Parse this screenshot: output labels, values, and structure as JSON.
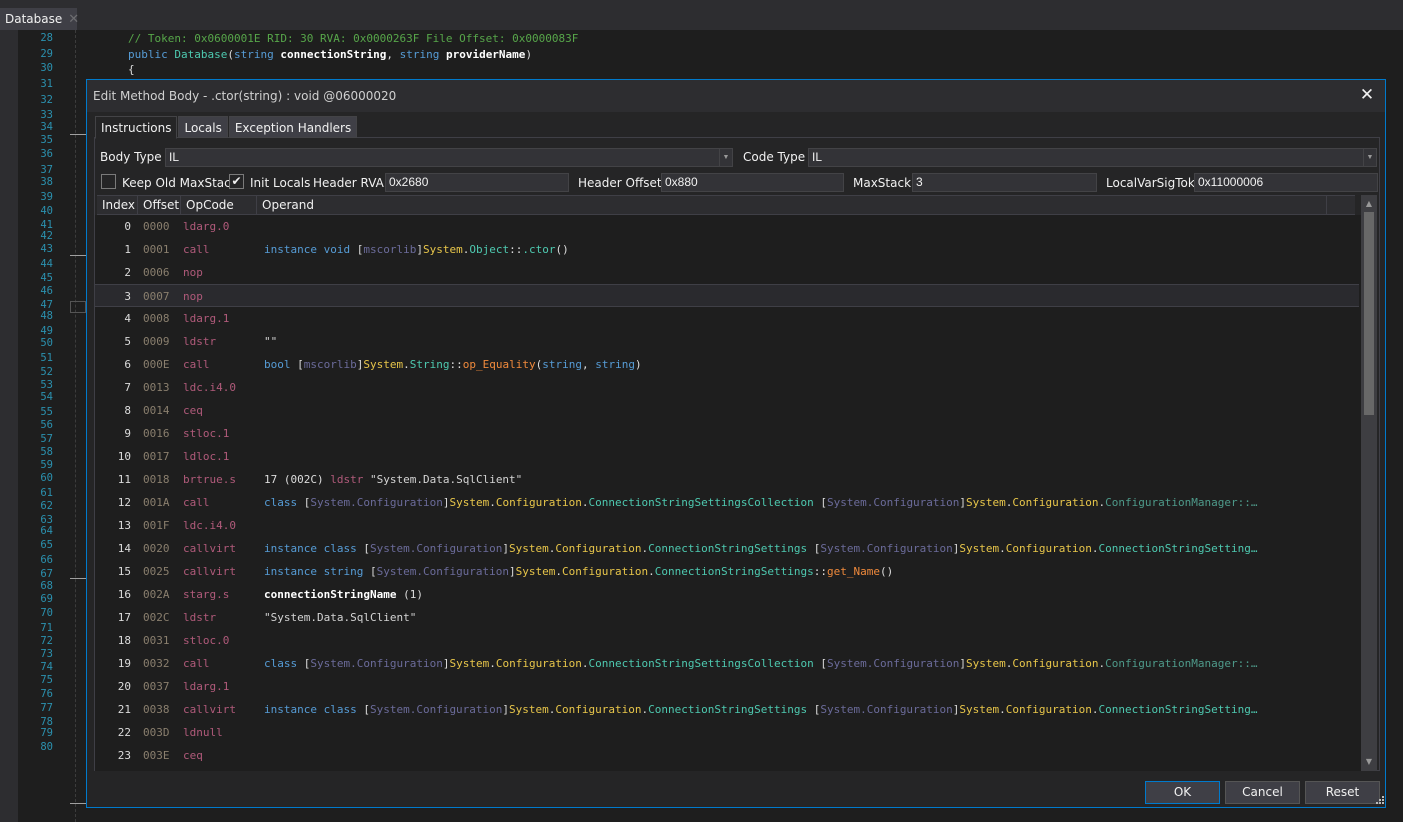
{
  "tab": {
    "label": "Database",
    "close_glyph": "✕"
  },
  "editor": {
    "line_numbers": [
      "28",
      "29",
      "30",
      "31",
      "32",
      "33",
      "34",
      "35",
      "36",
      "37",
      "38",
      "39",
      "40",
      "41",
      "42",
      "43",
      "44",
      "45",
      "46",
      "47",
      "48",
      "49",
      "50",
      "51",
      "52",
      "53",
      "54",
      "55",
      "56",
      "57",
      "58",
      "59",
      "60",
      "61",
      "62",
      "63",
      "64",
      "65",
      "66",
      "67",
      "68",
      "69",
      "70",
      "71",
      "72",
      "73",
      "74",
      "75",
      "76",
      "77",
      "78",
      "79",
      "80"
    ],
    "comment_line": "// Token: 0x0600001E RID: 30 RVA: 0x0000263F File Offset: 0x0000083F",
    "signature": {
      "kw_public": "public",
      "type_name": "Database",
      "open": "(",
      "kw_string1": "string",
      "param1": "connectionString",
      "comma": ", ",
      "kw_string2": "string",
      "param2": "providerName",
      "close": ")"
    },
    "brace": "{"
  },
  "dialog": {
    "title": "Edit Method Body - .ctor(string) : void @06000020",
    "close_glyph": "✕",
    "tabs": [
      {
        "label": "Instructions",
        "active": true
      },
      {
        "label": "Locals",
        "active": false
      },
      {
        "label": "Exception Handlers",
        "active": false
      }
    ],
    "body_type": {
      "label": "Body Type",
      "value": "IL"
    },
    "code_type": {
      "label": "Code Type",
      "value": "IL"
    },
    "keep_old_maxstack": {
      "label": "Keep Old MaxStack",
      "checked": false
    },
    "init_locals": {
      "label": "Init Locals",
      "checked": true,
      "check_glyph": "✔"
    },
    "header_rva": {
      "label": "Header RVA",
      "value": "0x2680"
    },
    "header_offset": {
      "label": "Header Offset",
      "value": "0x880"
    },
    "max_stack": {
      "label": "MaxStack",
      "value": "3"
    },
    "local_var_sig_tok": {
      "label": "LocalVarSigTok",
      "value": "0x11000006"
    },
    "columns": [
      "Index",
      "Offset",
      "OpCode",
      "Operand"
    ],
    "selected_index": 3,
    "instructions": [
      {
        "index": "0",
        "offset": "0000",
        "opcode": "ldarg.0",
        "operand": []
      },
      {
        "index": "1",
        "offset": "0001",
        "opcode": "call",
        "operand": [
          [
            "kw",
            "instance void "
          ],
          [
            "punc",
            "["
          ],
          [
            "asm",
            "mscorlib"
          ],
          [
            "punc",
            "]"
          ],
          [
            "ns",
            "System"
          ],
          [
            "punc",
            "."
          ],
          [
            "type",
            "Object"
          ],
          [
            "punc",
            "::"
          ],
          [
            "type",
            ".ctor"
          ],
          [
            "punc",
            "()"
          ]
        ]
      },
      {
        "index": "2",
        "offset": "0006",
        "opcode": "nop",
        "operand": []
      },
      {
        "index": "3",
        "offset": "0007",
        "opcode": "nop",
        "operand": []
      },
      {
        "index": "4",
        "offset": "0008",
        "opcode": "ldarg.1",
        "operand": []
      },
      {
        "index": "5",
        "offset": "0009",
        "opcode": "ldstr",
        "operand": [
          [
            "str",
            "\"\""
          ]
        ]
      },
      {
        "index": "6",
        "offset": "000E",
        "opcode": "call",
        "operand": [
          [
            "kw",
            "bool "
          ],
          [
            "punc",
            "["
          ],
          [
            "asm",
            "mscorlib"
          ],
          [
            "punc",
            "]"
          ],
          [
            "ns",
            "System"
          ],
          [
            "punc",
            "."
          ],
          [
            "type",
            "String"
          ],
          [
            "punc",
            "::"
          ],
          [
            "meth",
            "op_Equality"
          ],
          [
            "punc",
            "("
          ],
          [
            "kw",
            "string"
          ],
          [
            "punc",
            ", "
          ],
          [
            "kw",
            "string"
          ],
          [
            "punc",
            ")"
          ]
        ]
      },
      {
        "index": "7",
        "offset": "0013",
        "opcode": "ldc.i4.0",
        "operand": []
      },
      {
        "index": "8",
        "offset": "0014",
        "opcode": "ceq",
        "operand": []
      },
      {
        "index": "9",
        "offset": "0016",
        "opcode": "stloc.1",
        "operand": []
      },
      {
        "index": "10",
        "offset": "0017",
        "opcode": "ldloc.1",
        "operand": []
      },
      {
        "index": "11",
        "offset": "0018",
        "opcode": "brtrue.s",
        "operand": [
          [
            "num",
            "17 (002C) "
          ],
          [
            "op2",
            "ldstr "
          ],
          [
            "str",
            "\"System.Data.SqlClient\""
          ]
        ]
      },
      {
        "index": "12",
        "offset": "001A",
        "opcode": "call",
        "operand": [
          [
            "kw",
            "class "
          ],
          [
            "punc",
            "["
          ],
          [
            "asm",
            "System.Configuration"
          ],
          [
            "punc",
            "]"
          ],
          [
            "ns",
            "System"
          ],
          [
            "punc",
            "."
          ],
          [
            "ns",
            "Configuration"
          ],
          [
            "punc",
            "."
          ],
          [
            "type",
            "ConnectionStringSettingsCollection "
          ],
          [
            "punc",
            "["
          ],
          [
            "asm",
            "System.Configuration"
          ],
          [
            "punc",
            "]"
          ],
          [
            "ns",
            "System"
          ],
          [
            "punc",
            "."
          ],
          [
            "ns",
            "Configuration"
          ],
          [
            "punc",
            "."
          ],
          [
            "dim",
            "ConfigurationManager::…"
          ]
        ]
      },
      {
        "index": "13",
        "offset": "001F",
        "opcode": "ldc.i4.0",
        "operand": []
      },
      {
        "index": "14",
        "offset": "0020",
        "opcode": "callvirt",
        "operand": [
          [
            "kw",
            "instance class "
          ],
          [
            "punc",
            "["
          ],
          [
            "asm",
            "System.Configuration"
          ],
          [
            "punc",
            "]"
          ],
          [
            "ns",
            "System"
          ],
          [
            "punc",
            "."
          ],
          [
            "ns",
            "Configuration"
          ],
          [
            "punc",
            "."
          ],
          [
            "type",
            "ConnectionStringSettings "
          ],
          [
            "punc",
            "["
          ],
          [
            "asm",
            "System.Configuration"
          ],
          [
            "punc",
            "]"
          ],
          [
            "ns",
            "System"
          ],
          [
            "punc",
            "."
          ],
          [
            "ns",
            "Configuration"
          ],
          [
            "punc",
            "."
          ],
          [
            "type",
            "ConnectionStringSetting…"
          ]
        ]
      },
      {
        "index": "15",
        "offset": "0025",
        "opcode": "callvirt",
        "operand": [
          [
            "kw",
            "instance string "
          ],
          [
            "punc",
            "["
          ],
          [
            "asm",
            "System.Configuration"
          ],
          [
            "punc",
            "]"
          ],
          [
            "ns",
            "System"
          ],
          [
            "punc",
            "."
          ],
          [
            "ns",
            "Configuration"
          ],
          [
            "punc",
            "."
          ],
          [
            "type",
            "ConnectionStringSettings"
          ],
          [
            "punc",
            "::"
          ],
          [
            "meth",
            "get_Name"
          ],
          [
            "punc",
            "()"
          ]
        ]
      },
      {
        "index": "16",
        "offset": "002A",
        "opcode": "starg.s",
        "operand": [
          [
            "local",
            "connectionStringName"
          ],
          [
            "punc",
            " (1)"
          ]
        ]
      },
      {
        "index": "17",
        "offset": "002C",
        "opcode": "ldstr",
        "operand": [
          [
            "str",
            "\"System.Data.SqlClient\""
          ]
        ]
      },
      {
        "index": "18",
        "offset": "0031",
        "opcode": "stloc.0",
        "operand": []
      },
      {
        "index": "19",
        "offset": "0032",
        "opcode": "call",
        "operand": [
          [
            "kw",
            "class "
          ],
          [
            "punc",
            "["
          ],
          [
            "asm",
            "System.Configuration"
          ],
          [
            "punc",
            "]"
          ],
          [
            "ns",
            "System"
          ],
          [
            "punc",
            "."
          ],
          [
            "ns",
            "Configuration"
          ],
          [
            "punc",
            "."
          ],
          [
            "type",
            "ConnectionStringSettingsCollection "
          ],
          [
            "punc",
            "["
          ],
          [
            "asm",
            "System.Configuration"
          ],
          [
            "punc",
            "]"
          ],
          [
            "ns",
            "System"
          ],
          [
            "punc",
            "."
          ],
          [
            "ns",
            "Configuration"
          ],
          [
            "punc",
            "."
          ],
          [
            "dim",
            "ConfigurationManager::…"
          ]
        ]
      },
      {
        "index": "20",
        "offset": "0037",
        "opcode": "ldarg.1",
        "operand": []
      },
      {
        "index": "21",
        "offset": "0038",
        "opcode": "callvirt",
        "operand": [
          [
            "kw",
            "instance class "
          ],
          [
            "punc",
            "["
          ],
          [
            "asm",
            "System.Configuration"
          ],
          [
            "punc",
            "]"
          ],
          [
            "ns",
            "System"
          ],
          [
            "punc",
            "."
          ],
          [
            "ns",
            "Configuration"
          ],
          [
            "punc",
            "."
          ],
          [
            "type",
            "ConnectionStringSettings "
          ],
          [
            "punc",
            "["
          ],
          [
            "asm",
            "System.Configuration"
          ],
          [
            "punc",
            "]"
          ],
          [
            "ns",
            "System"
          ],
          [
            "punc",
            "."
          ],
          [
            "ns",
            "Configuration"
          ],
          [
            "punc",
            "."
          ],
          [
            "type",
            "ConnectionStringSetting…"
          ]
        ]
      },
      {
        "index": "22",
        "offset": "003D",
        "opcode": "ldnull",
        "operand": []
      },
      {
        "index": "23",
        "offset": "003E",
        "opcode": "ceq",
        "operand": []
      }
    ],
    "scroll": {
      "up_glyph": "▲",
      "down_glyph": "▼"
    },
    "buttons": {
      "ok": "OK",
      "cancel": "Cancel",
      "reset": "Reset"
    }
  }
}
